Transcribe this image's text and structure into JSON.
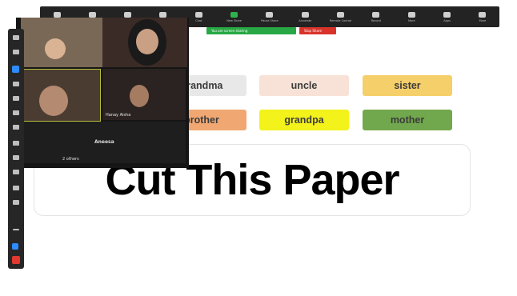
{
  "toolbar": {
    "items": [
      "Mute",
      "Stop Video",
      "Security",
      "Participants",
      "Chat",
      "New Share",
      "Pause Share",
      "Annotate",
      "Remote Control",
      "Record",
      "More",
      "Apps",
      "More"
    ]
  },
  "share_bar": {
    "status": "You are screen sharing",
    "stop_label": "Stop Share"
  },
  "gallery": {
    "tile_names": [
      "",
      "",
      "",
      "Hanay Aisha",
      "Aneesa"
    ],
    "footer": "2 others"
  },
  "words": {
    "row1": [
      {
        "text": "grandma",
        "color": "#e8e8e8"
      },
      {
        "text": "uncle",
        "color": "#f8e1d6"
      },
      {
        "text": "sister",
        "color": "#f5cf6a"
      }
    ],
    "row2": [
      {
        "text": "brother",
        "color": "#f0a772"
      },
      {
        "text": "grandpa",
        "color": "#f3f21b"
      },
      {
        "text": "mother",
        "color": "#72a84d"
      }
    ]
  },
  "paper": {
    "title": "Cut This Paper"
  },
  "colors": {
    "toolbar_bg": "#232323",
    "share_green": "#27a844",
    "share_red": "#d9342b",
    "annotate_bg": "#262626"
  }
}
